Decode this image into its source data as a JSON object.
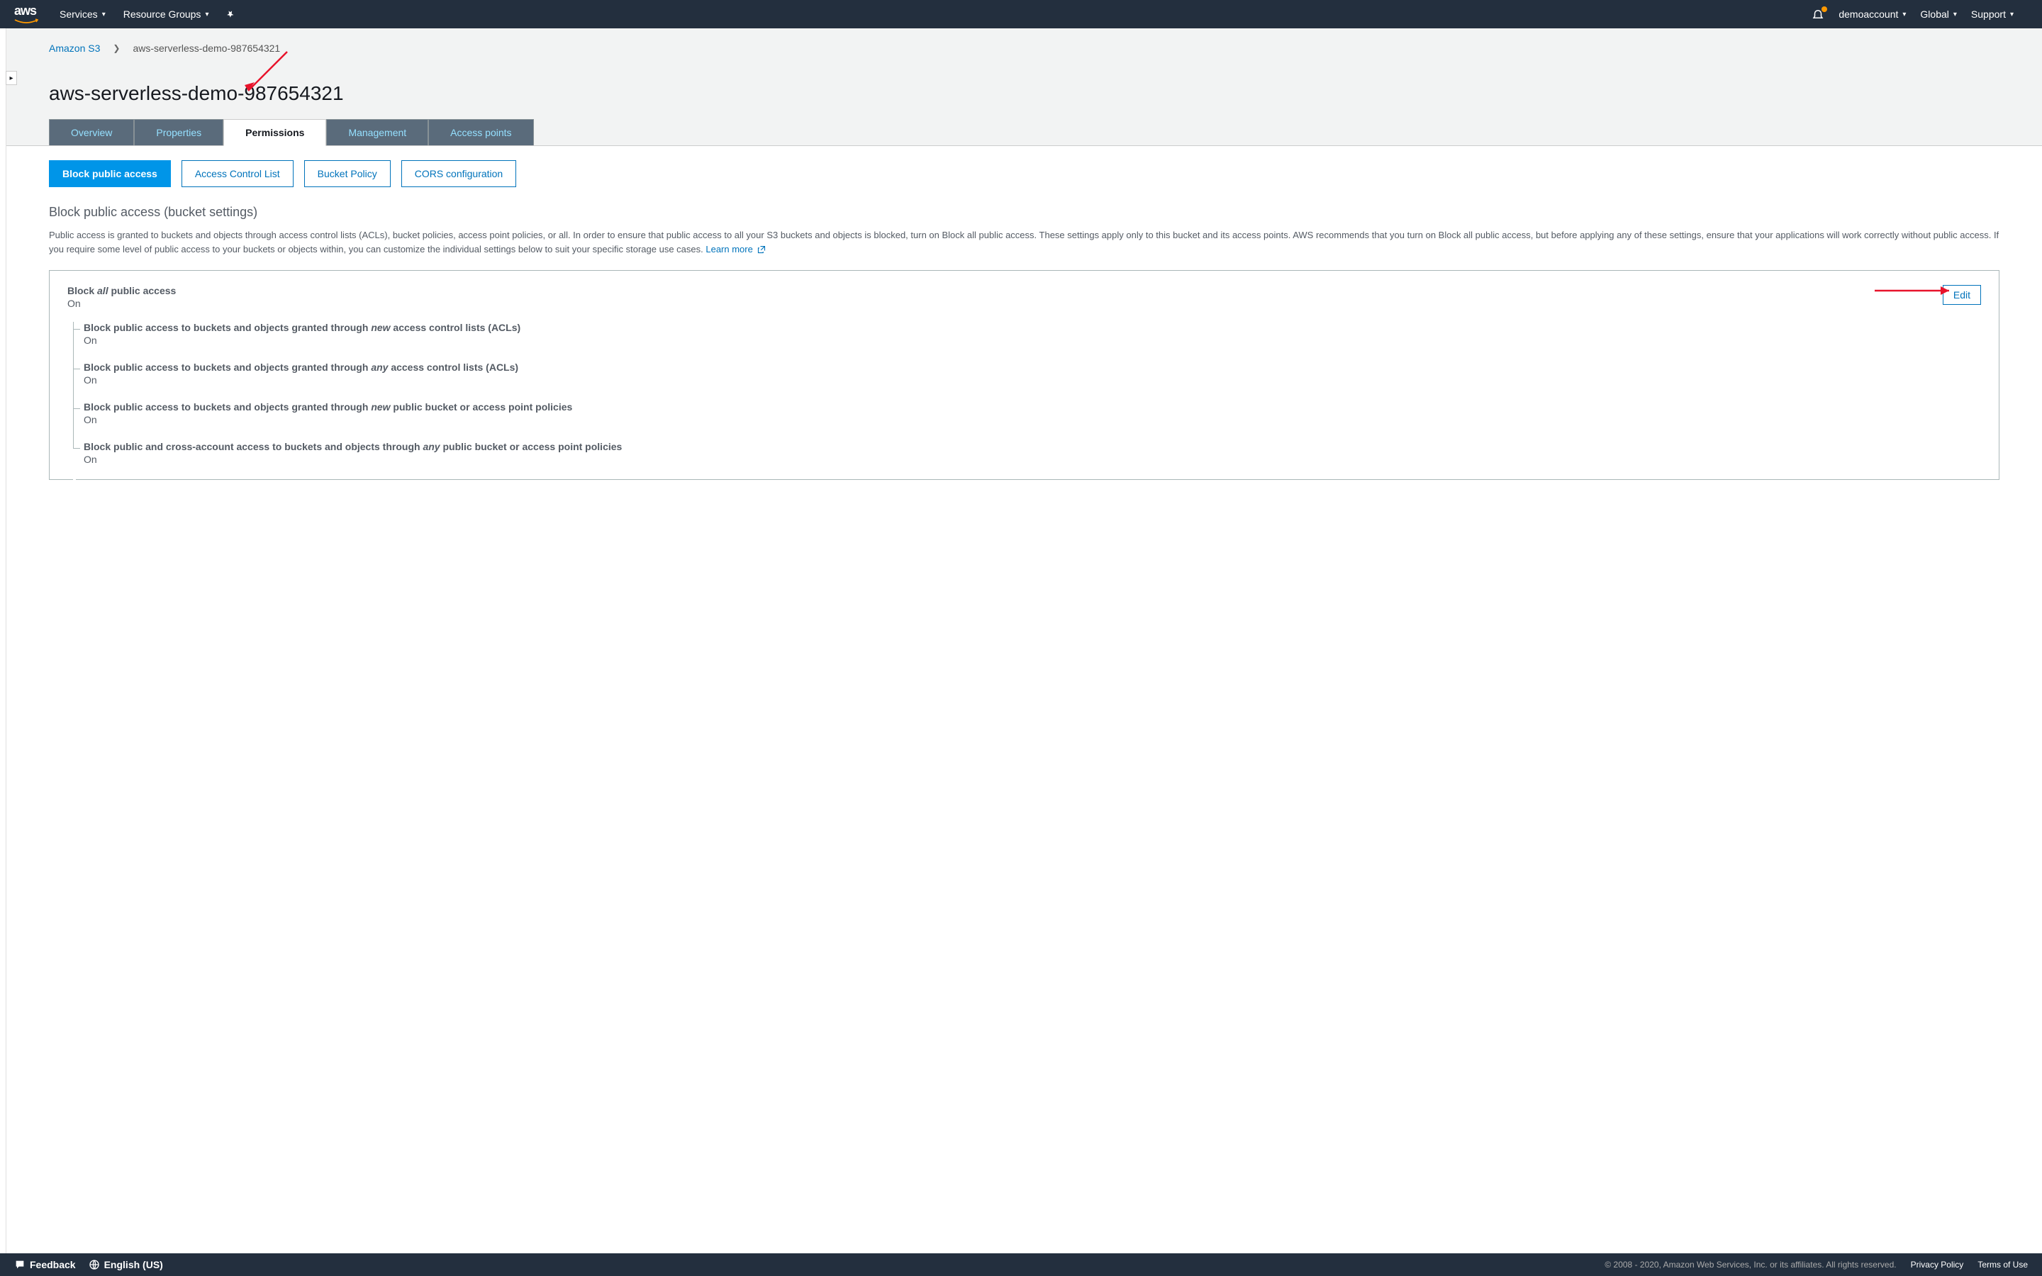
{
  "topnav": {
    "services": "Services",
    "resource_groups": "Resource Groups",
    "account": "demoaccount",
    "region": "Global",
    "support": "Support"
  },
  "breadcrumb": {
    "root": "Amazon S3",
    "current": "aws-serverless-demo-987654321"
  },
  "page_title": "aws-serverless-demo-987654321",
  "tabs": {
    "overview": "Overview",
    "properties": "Properties",
    "permissions": "Permissions",
    "management": "Management",
    "access_points": "Access points"
  },
  "subtabs": {
    "block_public_access": "Block public access",
    "acl": "Access Control List",
    "bucket_policy": "Bucket Policy",
    "cors": "CORS configuration"
  },
  "section": {
    "title": "Block public access (bucket settings)",
    "desc": "Public access is granted to buckets and objects through access control lists (ACLs), bucket policies, access point policies, or all. In order to ensure that public access to all your S3 buckets and objects is blocked, turn on Block all public access. These settings apply only to this bucket and its access points. AWS recommends that you turn on Block all public access, but before applying any of these settings, ensure that your applications will work correctly without public access. If you require some level of public access to your buckets or objects within, you can customize the individual settings below to suit your specific storage use cases. ",
    "learn_more": "Learn more"
  },
  "settings": {
    "block_all_pre": "Block ",
    "block_all_em": "all",
    "block_all_post": " public access",
    "block_all_status": "On",
    "edit": "Edit",
    "items": [
      {
        "pre": "Block public access to buckets and objects granted through ",
        "em": "new",
        "post": " access control lists (ACLs)",
        "status": "On"
      },
      {
        "pre": "Block public access to buckets and objects granted through ",
        "em": "any",
        "post": " access control lists (ACLs)",
        "status": "On"
      },
      {
        "pre": "Block public access to buckets and objects granted through ",
        "em": "new",
        "post": " public bucket or access point policies",
        "status": "On"
      },
      {
        "pre": "Block public and cross-account access to buckets and objects through ",
        "em": "any",
        "post": " public bucket or access point policies",
        "status": "On"
      }
    ]
  },
  "footer": {
    "feedback": "Feedback",
    "language": "English (US)",
    "copyright": "© 2008 - 2020, Amazon Web Services, Inc. or its affiliates. All rights reserved.",
    "privacy": "Privacy Policy",
    "terms": "Terms of Use"
  }
}
